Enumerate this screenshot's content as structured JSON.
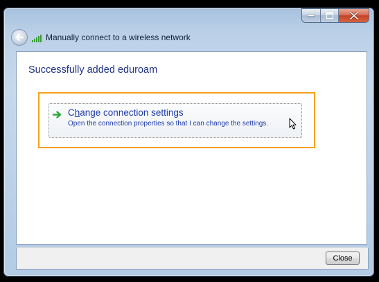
{
  "window": {
    "nav_title": "Manually connect to a wireless network"
  },
  "page": {
    "heading": "Successfully added eduroam",
    "command_link": {
      "title_before": "C",
      "title_accel": "h",
      "title_after": "ange connection settings",
      "description": "Open the connection properties so that I can change the settings."
    }
  },
  "footer": {
    "close_label": "Close"
  },
  "colors": {
    "highlight_border": "#f5a21b",
    "link_text": "#1f3ba8",
    "heading_text": "#1e3287",
    "arrow_green": "#2aa83a"
  },
  "icons": {
    "back": "back-arrow-icon",
    "network": "wireless-signal-icon",
    "command_link": "green-arrow-icon",
    "pointer": "mouse-pointer-icon",
    "minimize": "minimize-icon",
    "maximize": "maximize-icon",
    "close": "close-icon"
  }
}
